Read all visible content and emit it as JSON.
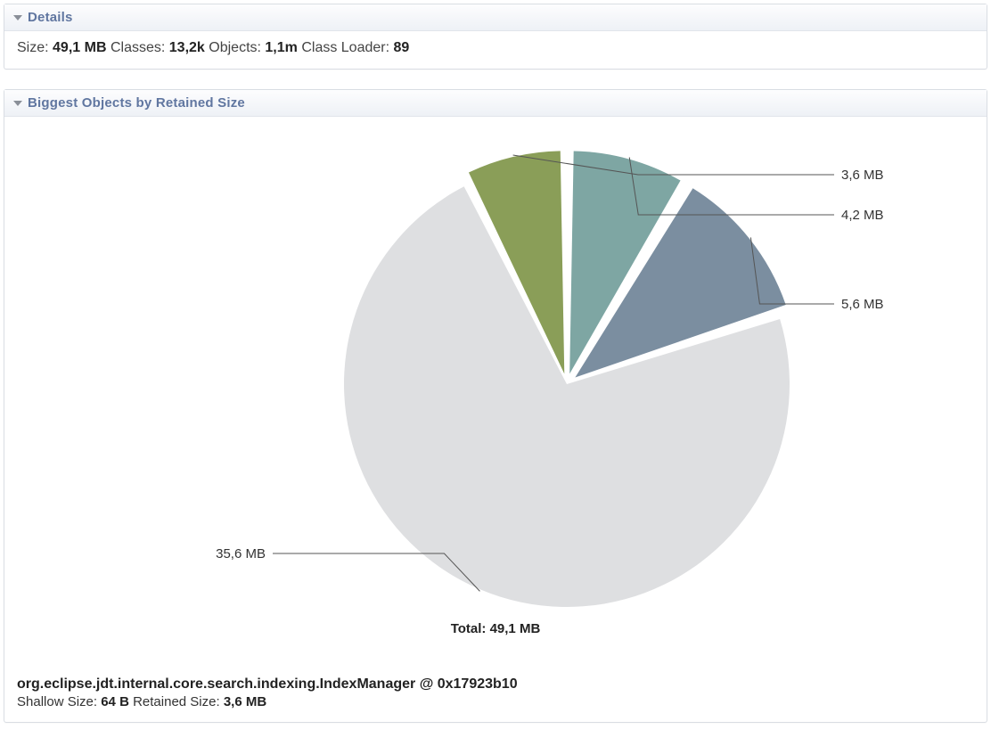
{
  "details": {
    "section_title": "Details",
    "size_label": "Size:",
    "size_value": "49,1 MB",
    "classes_label": "Classes:",
    "classes_value": "13,2k",
    "objects_label": "Objects:",
    "objects_value": "1,1m",
    "classloader_label": "Class Loader:",
    "classloader_value": "89"
  },
  "biggest": {
    "section_title": "Biggest Objects by Retained Size",
    "total_label": "Total: 49,1 MB",
    "selected_object": "org.eclipse.jdt.internal.core.search.indexing.IndexManager @ 0x17923b10",
    "shallow_label": "Shallow Size:",
    "shallow_value": "64 B",
    "retained_label": "Retained Size:",
    "retained_value": "3,6 MB"
  },
  "chart_data": {
    "type": "pie",
    "title": "Biggest Objects by Retained Size",
    "total_display": "Total: 49,1 MB",
    "units": "MB",
    "series": [
      {
        "name": "segment-3-6mb",
        "label": "3,6 MB",
        "value": 3.6,
        "color": "#8a9e58"
      },
      {
        "name": "segment-4-2mb",
        "label": "4,2 MB",
        "value": 4.2,
        "color": "#7ea6a3"
      },
      {
        "name": "segment-5-6mb",
        "label": "5,6 MB",
        "value": 5.6,
        "color": "#7b8ea0"
      },
      {
        "name": "segment-remainder",
        "label": "35,6 MB",
        "value": 35.6,
        "color": "#dedfe1"
      }
    ]
  }
}
